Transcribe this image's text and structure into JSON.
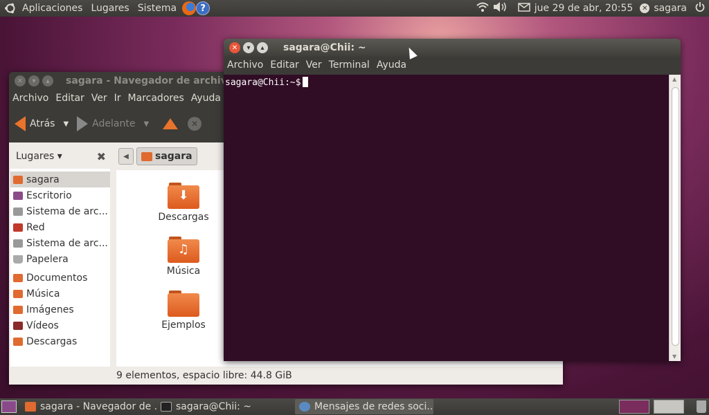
{
  "top_panel": {
    "menus": [
      "Aplicaciones",
      "Lugares",
      "Sistema"
    ],
    "datetime": "jue 29 de abr, 20:55",
    "user": "sagara"
  },
  "nautilus": {
    "title": "sagara - Navegador de archivos",
    "menus": [
      "Archivo",
      "Editar",
      "Ver",
      "Ir",
      "Marcadores",
      "Ayuda"
    ],
    "back_label": "Atrás",
    "forward_label": "Adelante",
    "places_label": "Lugares ▾",
    "path_current": "sagara",
    "sidebar": [
      {
        "label": "sagara",
        "color": "#e06a30",
        "selected": true
      },
      {
        "label": "Escritorio",
        "color": "#8a4a8a"
      },
      {
        "label": "Sistema de arc...",
        "color": "#888888"
      },
      {
        "label": "Red",
        "color": "#c0392b"
      },
      {
        "label": "Sistema de arc...",
        "color": "#888888"
      },
      {
        "label": "Papelera",
        "color": "#999999"
      },
      {
        "label": "Documentos",
        "color": "#e06a30"
      },
      {
        "label": "Música",
        "color": "#e06a30"
      },
      {
        "label": "Imágenes",
        "color": "#e06a30"
      },
      {
        "label": "Vídeos",
        "color": "#8a2a2a"
      },
      {
        "label": "Descargas",
        "color": "#e06a30"
      }
    ],
    "files": [
      {
        "label": "Descargas",
        "glyph": "⬇"
      },
      {
        "label": "Música",
        "glyph": "♫"
      },
      {
        "label": "Ejemplos",
        "glyph": ""
      }
    ],
    "status": "9 elementos, espacio libre: 44.8 GiB"
  },
  "terminal": {
    "title": "sagara@Chii: ~",
    "menus": [
      "Archivo",
      "Editar",
      "Ver",
      "Terminal",
      "Ayuda"
    ],
    "prompt": "sagara@Chii:~$"
  },
  "taskbar": [
    {
      "label": "sagara - Navegador de ...",
      "color": "#e06a30"
    },
    {
      "label": "sagara@Chii: ~",
      "color": "#222222"
    },
    {
      "label": "Mensajes de redes soci...",
      "color": "#5a8ac0",
      "active": true
    }
  ]
}
